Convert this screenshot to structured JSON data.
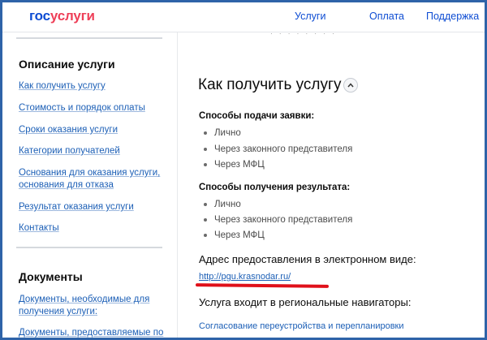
{
  "header": {
    "logo_part1": "гос",
    "logo_part2": "услуги",
    "nav": [
      "Услуги",
      "Оплата",
      "Поддержка"
    ]
  },
  "sidebar": {
    "section1_title": "Описание услуги",
    "section1_links": [
      "Как получить услугу",
      "Стоимость и порядок оплаты",
      "Сроки оказания услуги",
      "Категории получателей",
      "Основания для оказания услуги,",
      "основания для отказа",
      "Результат оказания услуги",
      "Контакты"
    ],
    "section2_title": "Документы",
    "section2_links": [
      "Документы, необходимые для",
      "получения услуги:",
      "Документы, предоставляемые по"
    ]
  },
  "main": {
    "title": "Как получить услугу",
    "submit_title": "Способы подачи заявки:",
    "submit_items": [
      "Лично",
      "Через законного представителя",
      "Через МФЦ"
    ],
    "result_title": "Способы получения результата:",
    "result_items": [
      "Лично",
      "Через законного представителя",
      "Через МФЦ"
    ],
    "address_title": "Адрес предоставления в электронном виде:",
    "address_link": "http://pgu.krasnodar.ru/",
    "region_title": "Услуга входит в региональные навигаторы:",
    "region_link": "Согласование переустройства и перепланировки"
  },
  "colors": {
    "frame": "#2e63a8",
    "link": "#1c5fb6",
    "logo_blue": "#0d4cd3",
    "logo_red": "#ee3f58",
    "annotation_red": "#e0101a"
  }
}
